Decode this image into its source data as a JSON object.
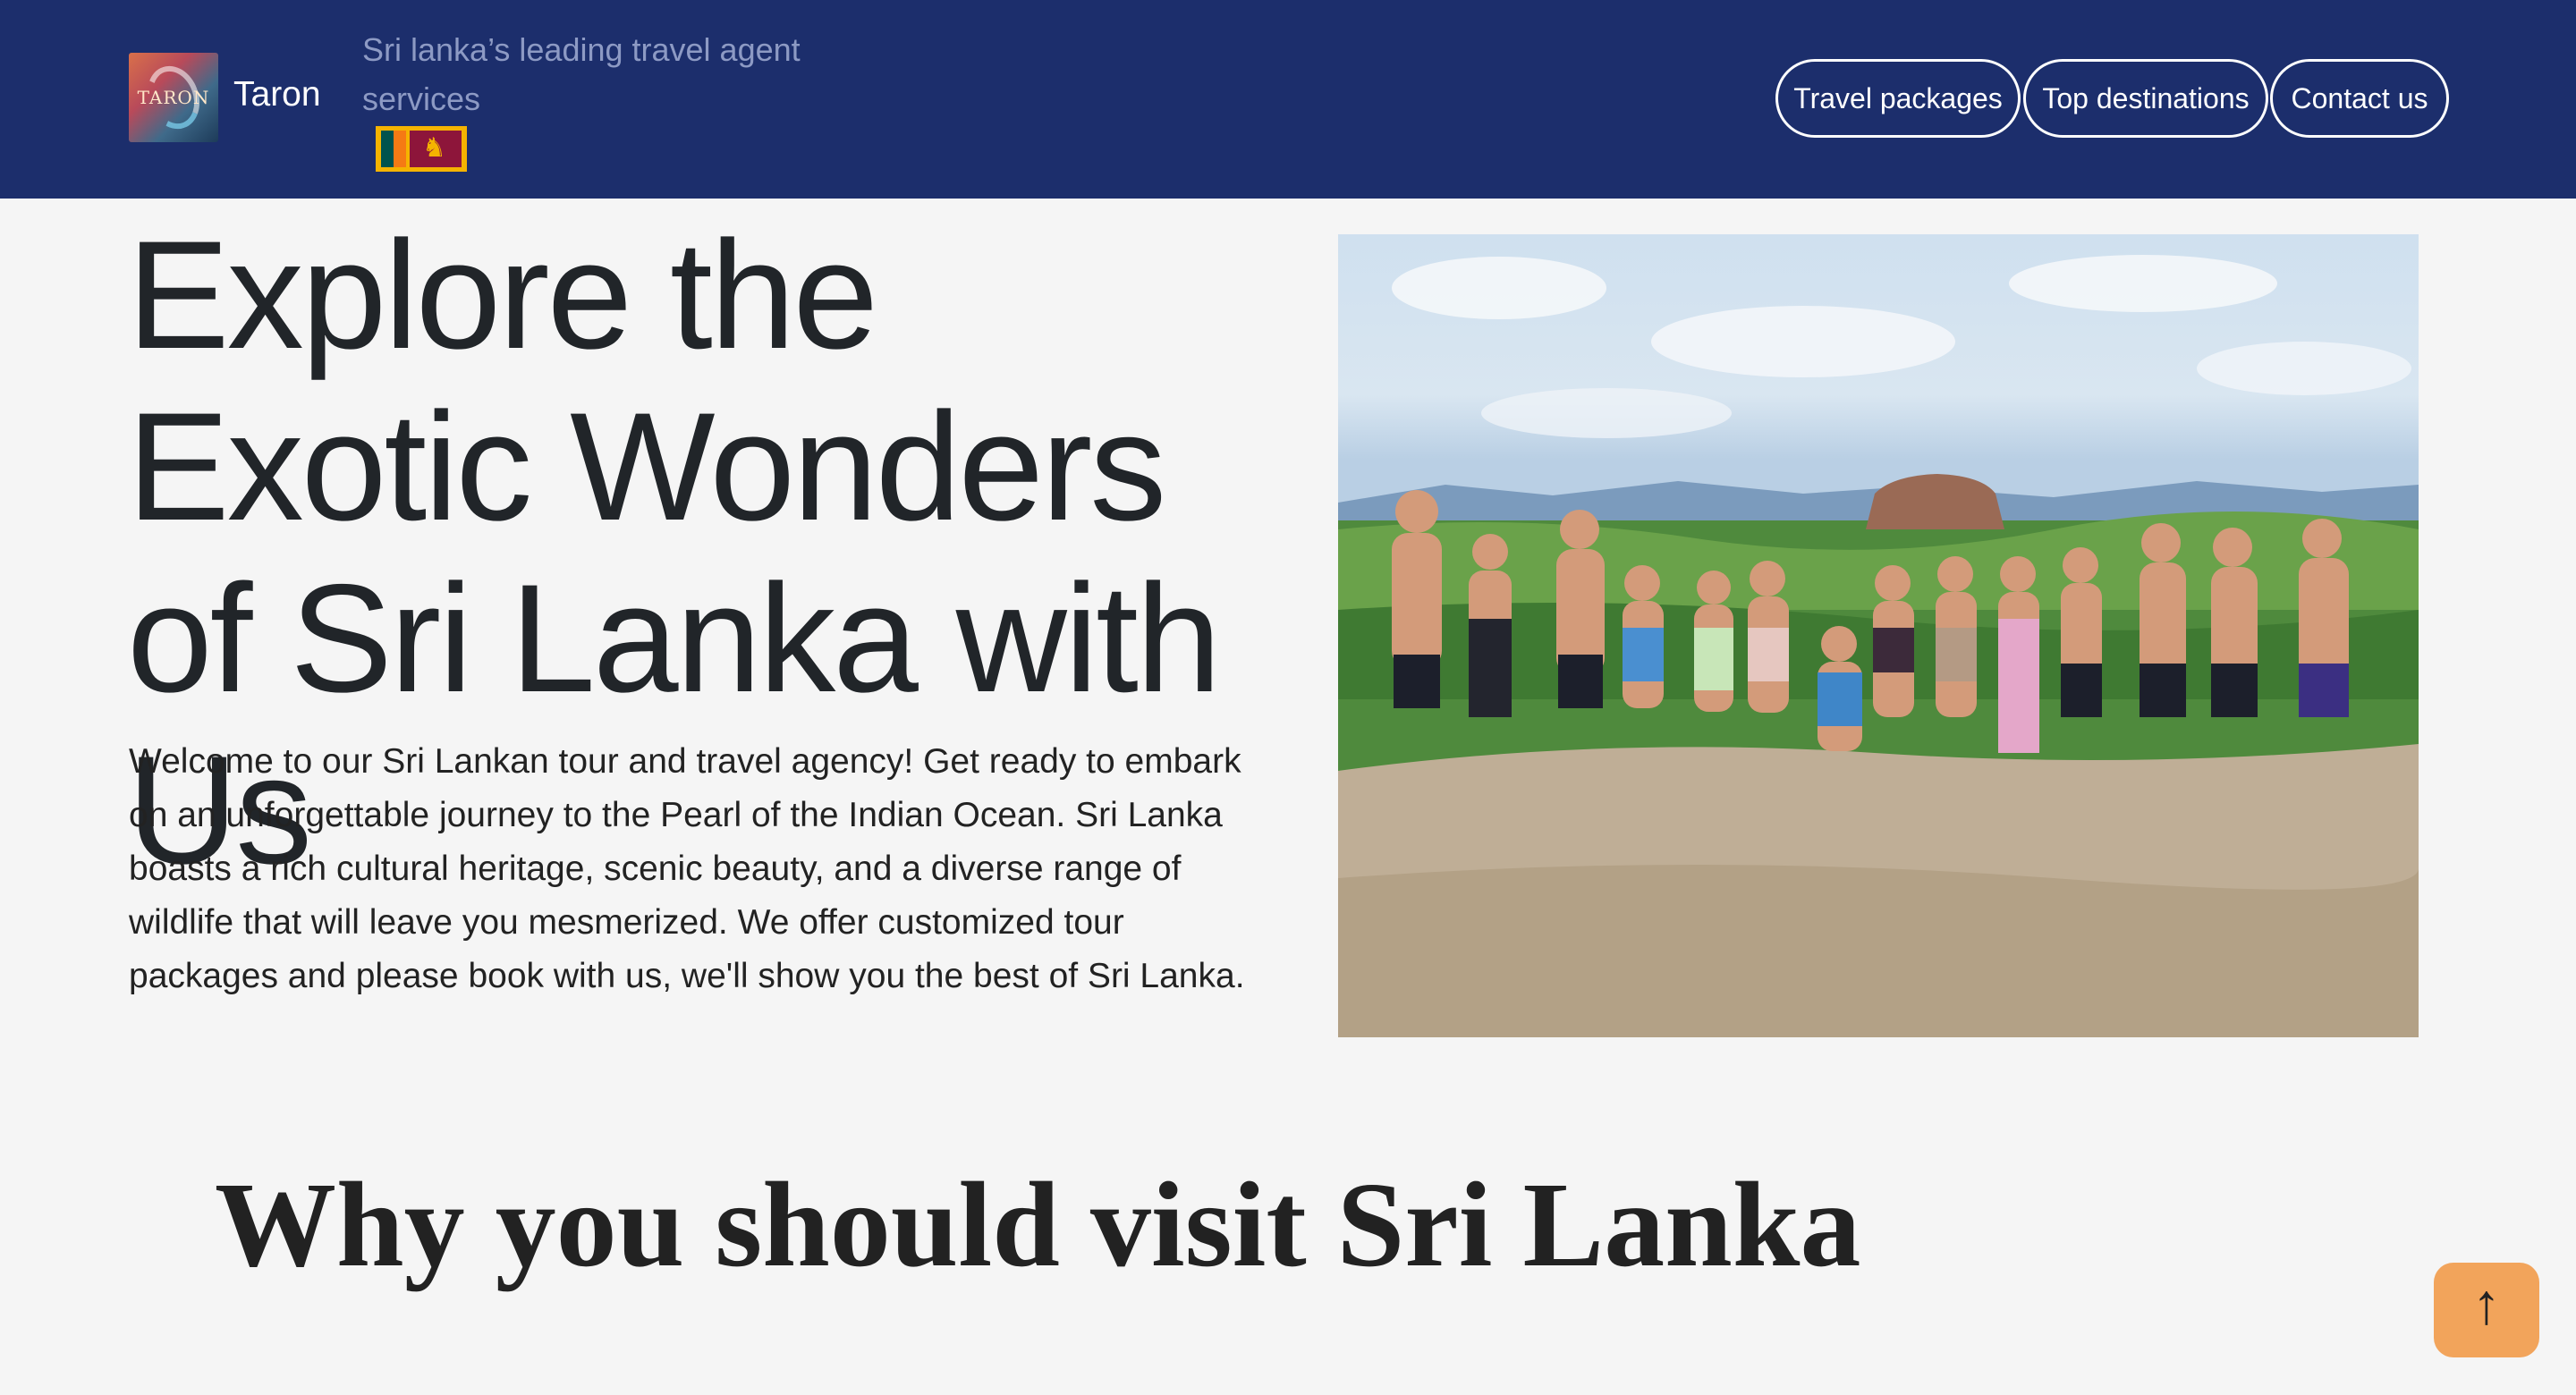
{
  "header": {
    "brand_name": "Taron",
    "logo_text": "TARON",
    "tagline": "Sri lanka’s leading travel agent services",
    "nav": {
      "travel_packages": "Travel packages",
      "top_destinations": "Top destinations",
      "contact_us": "Contact us"
    },
    "colors": {
      "background": "#1c2e6c",
      "tagline": "#8d9ac4"
    }
  },
  "hero": {
    "title": "Explore the Exotic Wonders of Sri Lanka with Us",
    "description": "Welcome to our Sri Lankan tour and travel agency! Get ready to embark on an unforgettable journey to the Pearl of the Indian Ocean. Sri Lanka boasts a rich cultural heritage, scenic beauty, and a diverse range of wildlife that will leave you mesmerized. We offer customized tour packages and please book with us, we'll show you the best of Sri Lanka.",
    "photo_subject": "group of travelers posing on a rock with a jungle and rock fortress behind"
  },
  "section": {
    "title": "Why you should visit Sri Lanka"
  },
  "scroll_top": {
    "icon": "arrow-up-icon",
    "color": "#f2a45b"
  }
}
